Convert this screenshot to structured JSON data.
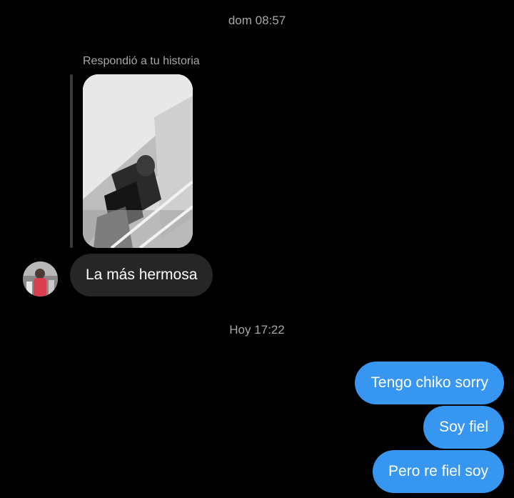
{
  "thread": {
    "timestamp_1": "dom 08:57",
    "reply_label": "Respondió a tu historia",
    "incoming_message": "La más hermosa",
    "timestamp_2": "Hoy 17:22",
    "outgoing_messages": [
      "Tengo chiko sorry",
      "Soy fiel",
      "Pero re fiel soy"
    ]
  },
  "colors": {
    "background": "#000000",
    "incoming_bubble": "#262626",
    "outgoing_bubble": "#3797f0",
    "secondary_text": "#a8a8a8"
  },
  "icons": {
    "avatar": "contact-avatar",
    "story": "story-thumbnail"
  }
}
